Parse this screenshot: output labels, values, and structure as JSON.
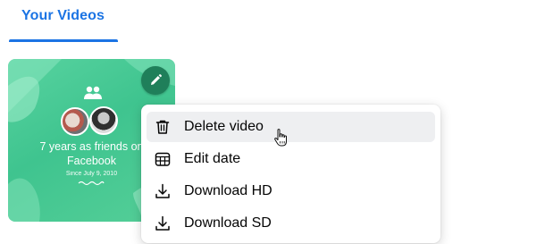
{
  "tabs": {
    "active_label": "Your Videos"
  },
  "video_card": {
    "title_line1": "7 years as friends on",
    "title_line2": "Facebook",
    "date_text": "Since July 9, 2010",
    "accent_color": "#3fc48f",
    "icon": "people-icon"
  },
  "edit_button": {
    "icon": "pencil-icon",
    "color": "#1f7f5a"
  },
  "context_menu": {
    "items": [
      {
        "label": "Delete video",
        "icon": "trash-icon",
        "highlighted": true
      },
      {
        "label": "Edit date",
        "icon": "calendar-icon",
        "highlighted": false
      },
      {
        "label": "Download HD",
        "icon": "download-icon",
        "highlighted": false
      },
      {
        "label": "Download SD",
        "icon": "download-icon",
        "highlighted": false
      }
    ]
  },
  "colors": {
    "brand_blue": "#1b74e4",
    "menu_hover": "#eeeff1",
    "text": "#050505"
  }
}
